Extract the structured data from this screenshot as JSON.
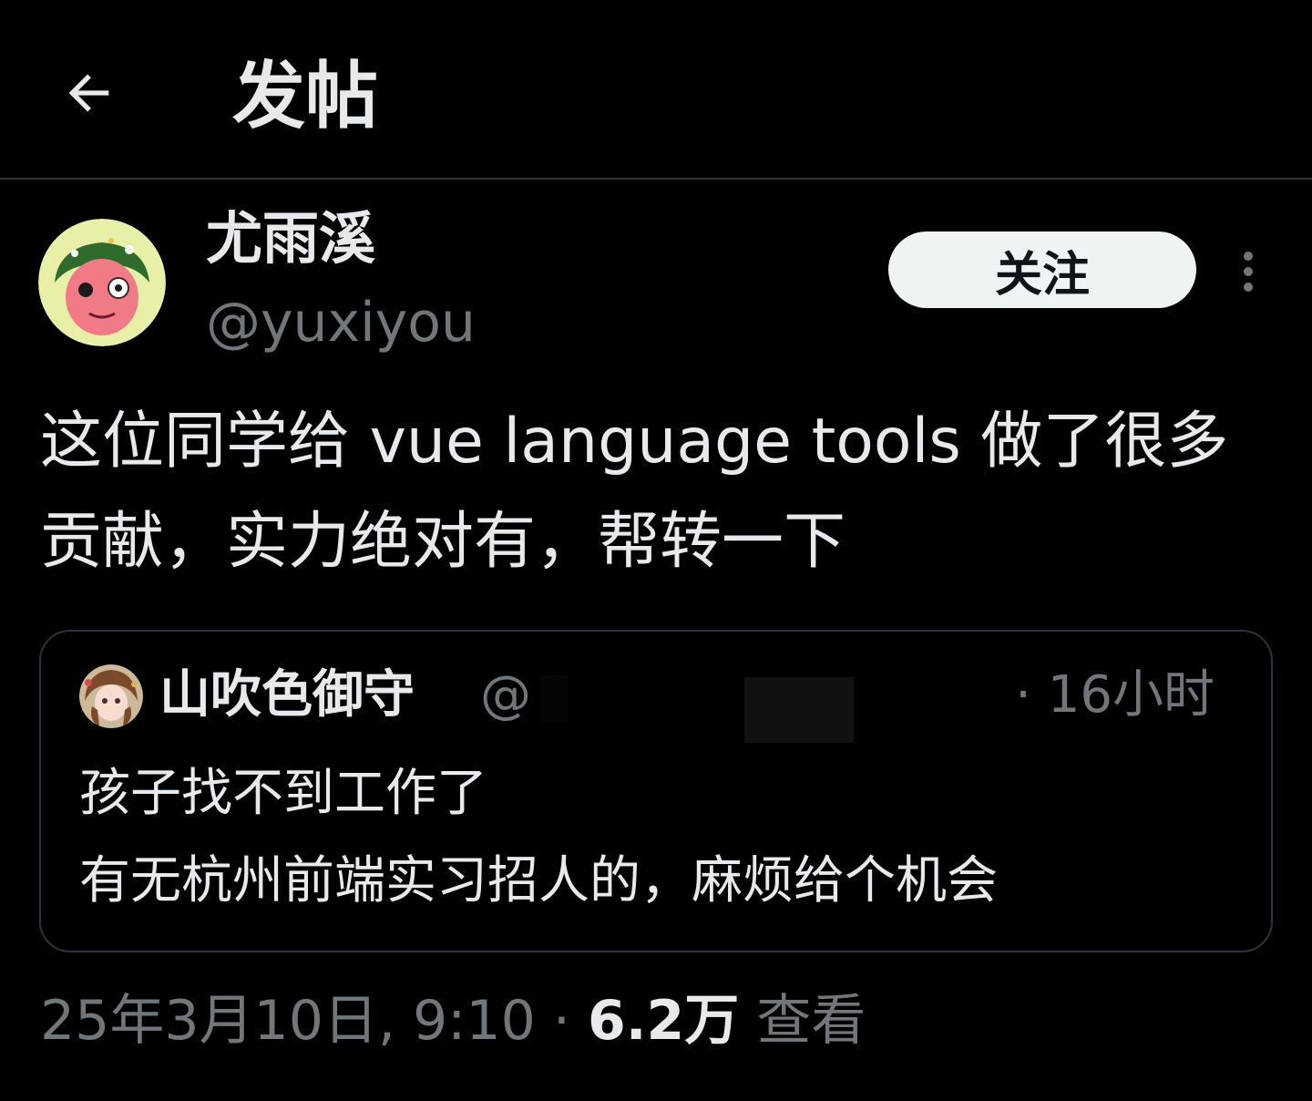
{
  "header": {
    "title": "发帖",
    "back_icon": "arrow-left-icon"
  },
  "post": {
    "author": {
      "display_name": "尤雨溪",
      "handle": "@yuxiyou"
    },
    "follow_label": "关注",
    "more_icon": "more-vertical-icon",
    "text": "这位同学给 vue language tools 做了很多贡献，实力绝对有，帮转一下",
    "quote": {
      "display_name": "山吹色御守",
      "handle": "@",
      "time": "· 16小时",
      "lines": [
        "孩子找不到工作了",
        "有无杭州前端实习招人的，麻烦给个机会"
      ]
    },
    "meta": {
      "timestamp": "25年3月10日, 9:10",
      "separator": " · ",
      "views_count": "6.2万",
      "views_label": " 查看"
    }
  },
  "colors": {
    "background": "#000000",
    "text_primary": "#e7e9ea",
    "text_secondary": "#71767b",
    "border": "#2f3336",
    "follow_button_bg": "#eff3f4"
  }
}
